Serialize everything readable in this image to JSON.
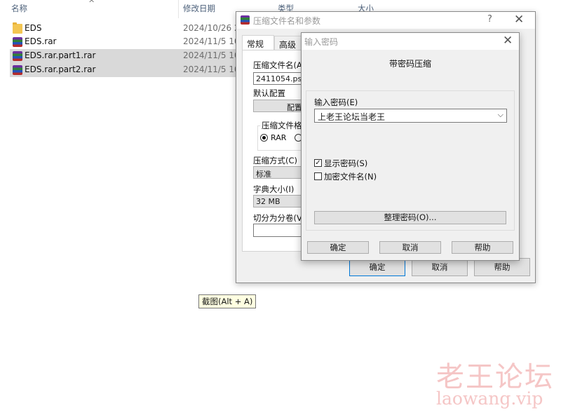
{
  "explorer": {
    "columns": [
      "名称",
      "修改日期",
      "类型",
      "大小"
    ],
    "files": [
      {
        "name": "EDS",
        "date": "2024/10/26 2:",
        "icon": "folder-icon"
      },
      {
        "name": "EDS.rar",
        "date": "2024/11/5 10:",
        "icon": "winrar-archive-icon"
      },
      {
        "name": "EDS.rar.part1.rar",
        "date": "2024/11/5 10:",
        "icon": "winrar-archive-icon"
      },
      {
        "name": "EDS.rar.part2.rar",
        "date": "2024/11/5 10:",
        "icon": "winrar-archive-icon"
      }
    ]
  },
  "archive_dialog": {
    "title": "压缩文件名和参数",
    "help": "?",
    "close": "✕",
    "tabs": [
      "常规",
      "高级"
    ],
    "archive_name_label": "压缩文件名(A",
    "archive_name_value": "2411054.psd",
    "default_profile_label": "默认配置",
    "profile_button": "配置",
    "format_label": "压缩文件格式",
    "format_rar": "RAR",
    "method_label": "压缩方式(C)",
    "method_value": "标准",
    "dict_label": "字典大小(I)",
    "dict_value": "32 MB",
    "split_label": "切分为分卷(V",
    "buttons": {
      "ok": "确定",
      "cancel": "取消",
      "help": "帮助"
    }
  },
  "password_dialog": {
    "title": "输入密码",
    "close": "✕",
    "heading": "带密码压缩",
    "password_label": "输入密码(E)",
    "password_value": "上老王论坛当老王",
    "show_password": "显示密码(S)",
    "show_password_checked": true,
    "encrypt_names": "加密文件名(N)",
    "encrypt_names_checked": false,
    "organize_button": "整理密码(O)...",
    "buttons": {
      "ok": "确定",
      "cancel": "取消",
      "help": "帮助"
    }
  },
  "tooltip": "截图(Alt + A)",
  "watermark": {
    "cn": "老王论坛",
    "en": "laowang.vip"
  },
  "colors": {
    "selection": "#cce8ff",
    "accent": "#0078d7",
    "watermark": "#f5c6c6"
  }
}
